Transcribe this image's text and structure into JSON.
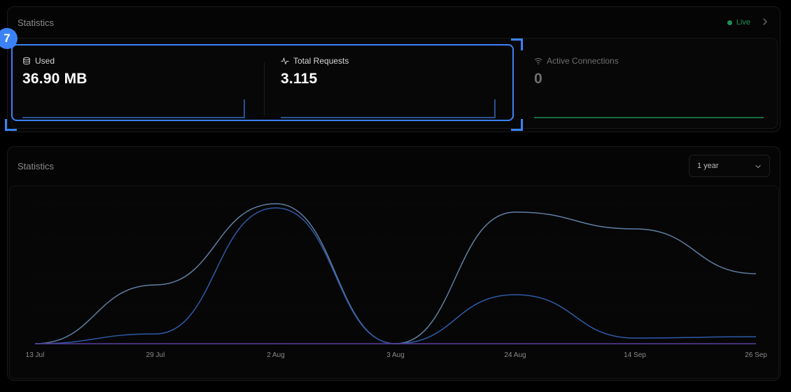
{
  "top_panel": {
    "title": "Statistics",
    "live_label": "Live"
  },
  "stats": [
    {
      "label": "Used",
      "value": "36.90 MB",
      "icon": "database-icon"
    },
    {
      "label": "Total Requests",
      "value": "3.115",
      "icon": "activity-icon"
    },
    {
      "label": "Active Connections",
      "value": "0",
      "icon": "wifi-icon"
    }
  ],
  "bottom_panel": {
    "title": "Statistics",
    "range_select": {
      "value": "1 year"
    }
  },
  "highlight": {
    "badge": "7",
    "color": "#3b82f6"
  },
  "colors": {
    "accent": "#3b82f6",
    "live": "#1f8f55",
    "series_light": "#5f7fa3",
    "series_dark": "#2f5aa8",
    "series_purple": "#5b3fa0"
  },
  "chart_data": {
    "type": "line",
    "x": [
      "13 Jul",
      "29 Jul",
      "2 Aug",
      "3 Aug",
      "24 Aug",
      "14 Sep",
      "26 Sep"
    ],
    "series": [
      {
        "values": [
          0,
          0.42,
          1.0,
          0,
          0.94,
          0.82,
          0.5
        ]
      },
      {
        "values": [
          0,
          0.07,
          0.97,
          0,
          0.35,
          0.04,
          0.05
        ]
      },
      {
        "values": [
          0,
          0,
          0,
          0,
          0,
          0,
          0
        ]
      }
    ]
  }
}
